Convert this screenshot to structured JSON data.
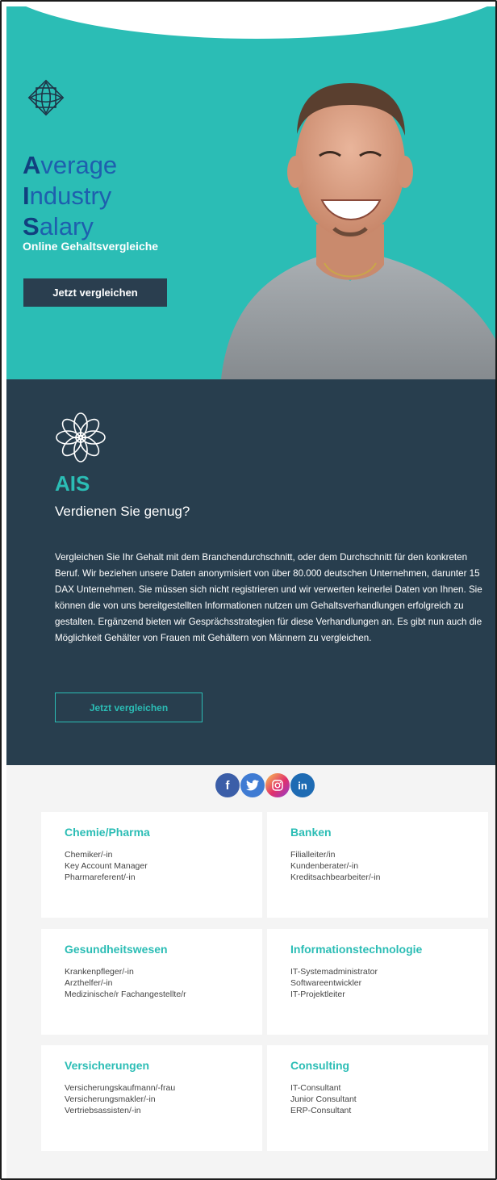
{
  "hero": {
    "brand_line1_initial": "A",
    "brand_line1_rest": "verage",
    "brand_line2_initial": "I",
    "brand_line2_rest": "ndustry",
    "brand_line3_initial": "S",
    "brand_line3_rest": "alary",
    "subtitle": "Online Gehaltsvergleiche",
    "cta_label": "Jetzt vergleichen"
  },
  "about": {
    "title": "AIS",
    "question": "Verdienen Sie genug?",
    "text": "Vergleichen Sie Ihr Gehalt mit dem Branchendurchschnitt, oder dem Durchschnitt für den konkreten Beruf. Wir beziehen unsere Daten anonymisiert von über 80.000 deutschen Unternehmen, darunter 15 DAX Unternehmen. Sie müssen sich nicht registrieren und wir verwerten keinerlei Daten von Ihnen. Sie können die von uns bereitgestellten Informationen nutzen um Gehaltsverhandlungen erfolgreich zu gestalten. Ergänzend bieten wir Gesprächsstrategien für diese Verhandlungen an. Es gibt nun auch die Möglichkeit Gehälter von Frauen mit Gehältern von Männern zu vergleichen.",
    "cta_label": "Jetzt vergleichen"
  },
  "social": {
    "facebook": "f",
    "twitter": "t",
    "instagram": "ig",
    "linkedin": "in"
  },
  "categories": [
    {
      "title": "Chemie/Pharma",
      "items": [
        "Chemiker/-in",
        "Key Account Manager",
        "Pharmareferent/-in"
      ]
    },
    {
      "title": "Banken",
      "items": [
        "Filialleiter/in",
        "Kundenberater/-in",
        "Kreditsachbearbeiter/-in"
      ]
    },
    {
      "title": "Gesundheitswesen",
      "items": [
        "Krankenpfleger/-in",
        "Arzthelfer/-in",
        "Medizinische/r Fachangestellte/r"
      ]
    },
    {
      "title": "Informationstechnologie",
      "items": [
        "IT-Systemadministrator",
        "Softwareentwickler",
        "IT-Projektleiter"
      ]
    },
    {
      "title": "Versicherungen",
      "items": [
        "Versicherungskaufmann/-frau",
        "Versicherungsmakler/-in",
        "Vertriebsassisten/-in"
      ]
    },
    {
      "title": "Consulting",
      "items": [
        "IT-Consultant",
        "Junior Consultant",
        "ERP-Consultant"
      ]
    }
  ],
  "colors": {
    "teal": "#2bbdb5",
    "navy": "#283e4e",
    "brand_blue": "#1e5fae"
  }
}
